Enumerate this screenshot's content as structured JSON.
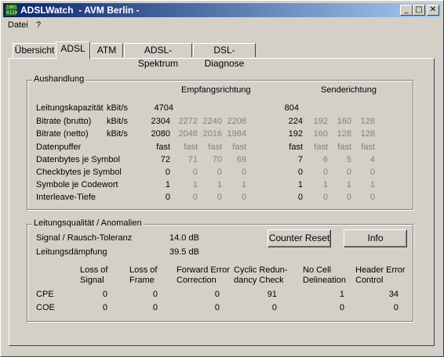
{
  "window": {
    "title": "ADSLWatch  - AVM Berlin -",
    "minimize": "_",
    "maximize": "□",
    "close": "✕"
  },
  "menu": [
    "Datei",
    "?"
  ],
  "tabs": [
    "Übersicht",
    "ADSL",
    "ATM",
    "ADSL-Spektrum",
    "DSL-Diagnose"
  ],
  "active_tab": "ADSL",
  "aushandlung": {
    "title": "Aushandlung",
    "header_empfang": "Empfangsrichtung",
    "header_sende": "Senderichtung",
    "rows": [
      {
        "label": "Leitungskapazität",
        "unit": "kBit/s",
        "empfang": [
          "4704"
        ],
        "sende": [
          "804"
        ]
      },
      {
        "label": "Bitrate (brutto)",
        "unit": "kBit/s",
        "empfang": [
          "2304",
          "2272",
          "2240",
          "2208"
        ],
        "sende": [
          "224",
          "192",
          "160",
          "128"
        ]
      },
      {
        "label": "Bitrate (netto)",
        "unit": "kBit/s",
        "empfang": [
          "2080",
          "2048",
          "2016",
          "1984"
        ],
        "sende": [
          "192",
          "160",
          "128",
          "128"
        ]
      },
      {
        "label": "Datenpuffer",
        "unit": "",
        "empfang": [
          "fast",
          "fast",
          "fast",
          "fast"
        ],
        "sende": [
          "fast",
          "fast",
          "fast",
          "fast"
        ]
      },
      {
        "label": "Datenbytes je Symbol",
        "unit": "",
        "empfang": [
          "72",
          "71",
          "70",
          "69"
        ],
        "sende": [
          "7",
          "6",
          "5",
          "4"
        ]
      },
      {
        "label": "Checkbytes je Symbol",
        "unit": "",
        "empfang": [
          "0",
          "0",
          "0",
          "0"
        ],
        "sende": [
          "0",
          "0",
          "0",
          "0"
        ]
      },
      {
        "label": "Symbole je Codewort",
        "unit": "",
        "empfang": [
          "1",
          "1",
          "1",
          "1"
        ],
        "sende": [
          "1",
          "1",
          "1",
          "1"
        ]
      },
      {
        "label": "Interleave-Tiefe",
        "unit": "",
        "empfang": [
          "0",
          "0",
          "0",
          "0"
        ],
        "sende": [
          "0",
          "0",
          "0",
          "0"
        ]
      }
    ]
  },
  "qualitaet": {
    "title": "Leitungsqualität / Anomalien",
    "signal_label": "Signal / Rausch-Toleranz",
    "signal_value": "14.0 dB",
    "daempfung_label": "Leitungsdämpfung",
    "daempfung_value": "39.5 dB",
    "counter_reset": "Counter Reset",
    "info": "Info",
    "columns": [
      [
        "Loss of",
        "Signal"
      ],
      [
        "Loss of",
        "Frame"
      ],
      [
        "Forward Error",
        "Correction"
      ],
      [
        "Cyclic Redun-",
        "dancy Check"
      ],
      [
        "No Cell",
        "Delineation"
      ],
      [
        "Header Error",
        "Control"
      ]
    ],
    "rows": [
      {
        "label": "CPE",
        "values": [
          "0",
          "0",
          "0",
          "91",
          "1",
          "34"
        ]
      },
      {
        "label": "COE",
        "values": [
          "0",
          "0",
          "0",
          "0",
          "0",
          "0"
        ]
      }
    ]
  }
}
